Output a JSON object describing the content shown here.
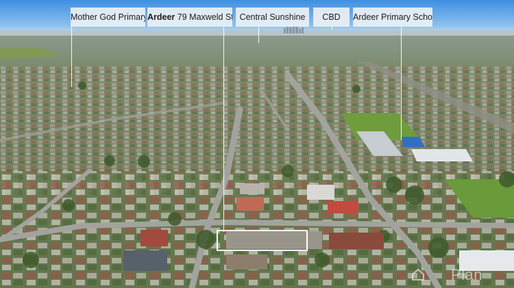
{
  "photo": {
    "labels": [
      {
        "text": "Mother God Primary"
      },
      {
        "bold": "Ardeer",
        "text": "79 Maxweld St."
      },
      {
        "text": "Central Sunshine"
      },
      {
        "text": "CBD"
      },
      {
        "text": "Ardeer Primary School"
      }
    ],
    "watermark": "Plan",
    "watermark_icon": "house-icon"
  }
}
